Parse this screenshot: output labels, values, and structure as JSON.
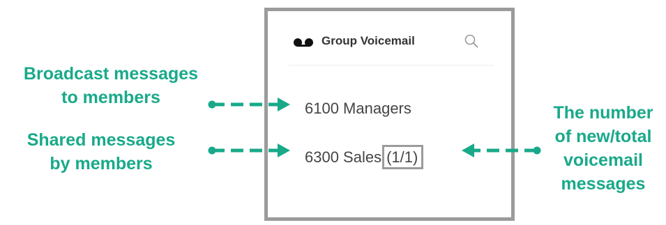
{
  "panel": {
    "title": "Group Voicemail",
    "icons": {
      "voicemail": "voicemail-icon",
      "search": "search-icon"
    },
    "items": [
      {
        "name": "6100 Managers",
        "count": ""
      },
      {
        "name": "6300 Sales",
        "count": "(1/1)"
      }
    ]
  },
  "annotations": {
    "broadcast": [
      "Broadcast messages",
      "to members"
    ],
    "shared": [
      "Shared messages",
      "by members"
    ],
    "count": [
      "The number",
      "of new/total",
      "voicemail",
      "messages"
    ]
  },
  "colors": {
    "annotation": "#19a98a",
    "border": "#9b9b9b",
    "text": "#444444"
  }
}
